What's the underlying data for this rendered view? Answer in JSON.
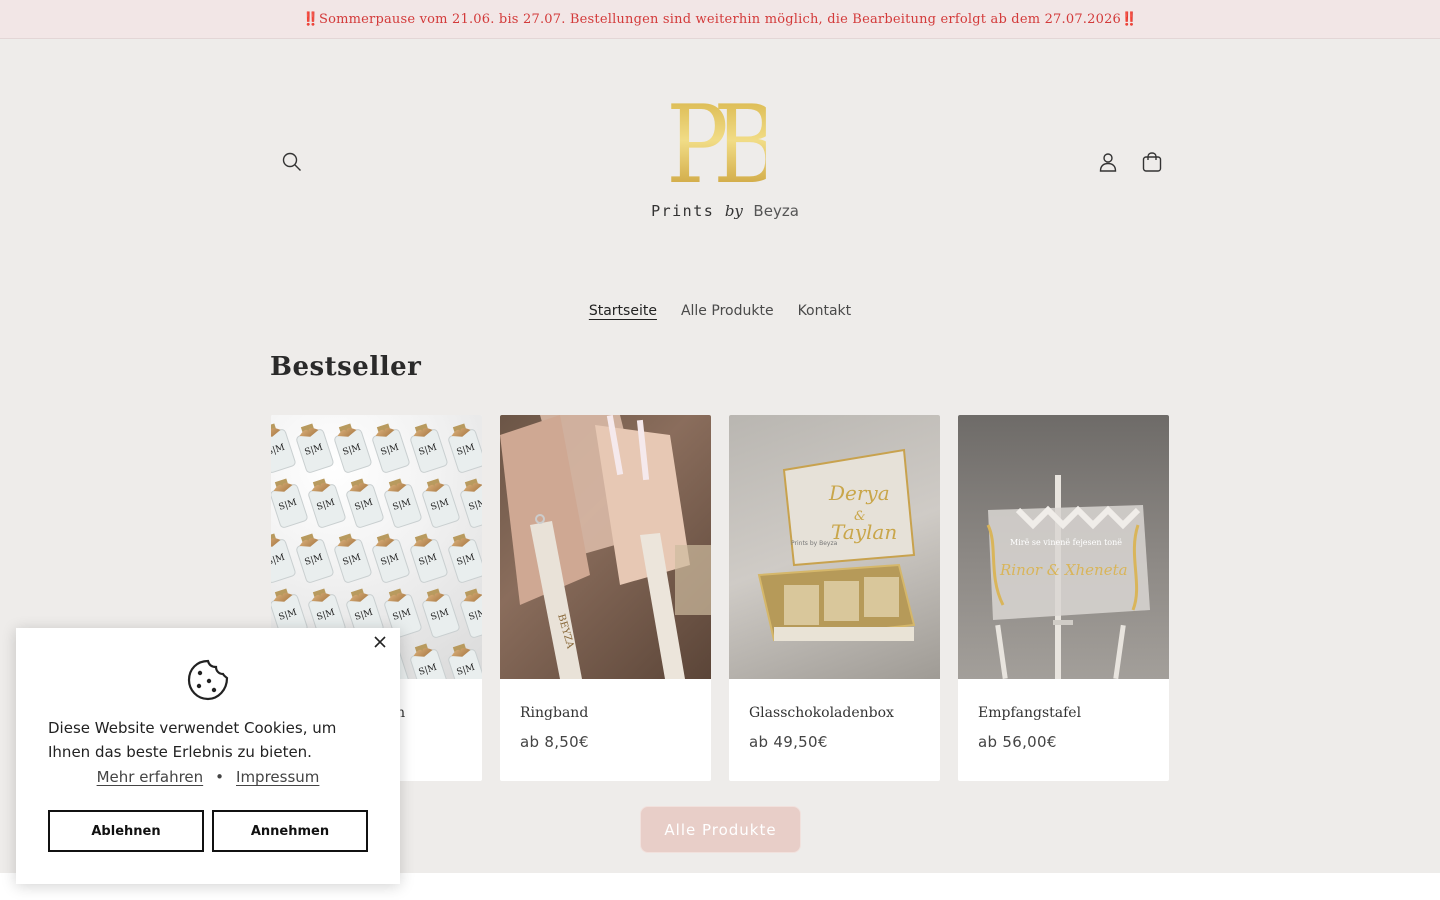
{
  "announcement": {
    "text": "Sommerpause vom 21.06. bis 27.07. Bestellungen sind weiterhin möglich, die Bearbeitung erfolgt ab dem 27.07.2026",
    "mark": "‼️"
  },
  "logo": {
    "mark": "PB",
    "prints": "Prints",
    "by": "by",
    "name": "Beyza"
  },
  "nav": {
    "items": [
      "Startseite",
      "Alle Produkte",
      "Kontakt"
    ],
    "active": "Startseite"
  },
  "section": {
    "title": "Bestseller"
  },
  "products": [
    {
      "title": "Fläschchen",
      "title_visible_suffix": "chen",
      "price": ""
    },
    {
      "title": "Ringband",
      "price": "ab 8,50€"
    },
    {
      "title": "Glasschokoladenbox",
      "price": "ab 49,50€"
    },
    {
      "title": "Empfangstafel",
      "price": "ab 56,00€"
    }
  ],
  "image_labels": {
    "bottle_initials": "S|M",
    "ring_band_text": "BEYZA",
    "box_names": [
      "Derya",
      "&",
      "Taylan"
    ],
    "box_small": "Prints by Beyza",
    "tafel_line1": "Mirë se vinenë fejesen tonë",
    "tafel_names": "Rinor & Xheneta"
  },
  "cta": {
    "all_products": "Alle Produkte"
  },
  "cookie": {
    "text": "Diese Website verwendet Cookies, um Ihnen das beste Erlebnis zu bieten.",
    "learn_more": "Mehr erfahren",
    "separator": "•",
    "imprint": "Impressum",
    "decline": "Ablehnen",
    "accept": "Annehmen"
  },
  "colors": {
    "background": "#eeecea",
    "announcement_bg": "#f2e6e6",
    "announcement_text": "#d33a3a",
    "logo_gold": "#d8b54a",
    "cta_bg": "#e8cec8"
  },
  "icons": {
    "search": "search-icon",
    "account": "account-icon",
    "cart": "cart-icon",
    "close": "close-icon",
    "cookie": "cookie-icon"
  }
}
